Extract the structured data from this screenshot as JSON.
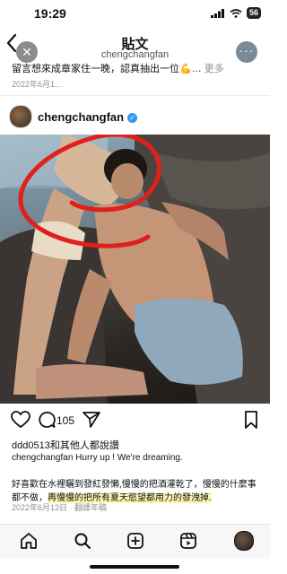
{
  "status": {
    "time": "19:29",
    "battery": "56"
  },
  "header": {
    "title": "貼文",
    "subtitle": "chengchangfan"
  },
  "previous_post": {
    "caption": "留言想來成章家住一晚，認真抽出一位💪…",
    "more": "更多",
    "date": "2022年6月1…"
  },
  "post": {
    "username": "chengchangfan",
    "likes_count": "105",
    "likes_text": "ddd0513和其他人都說讚",
    "caption_user": "chengchangfan",
    "caption_head": " Hurry up ! We're dreaming.",
    "caption_body": "好喜歡在水裡曬到發紅發懶,慢慢的把酒灌乾了，慢慢的什麼事都不做，",
    "caption_highlight": "再慢慢的把所有夏天慾望都用力的發洩掉.",
    "date": "2022年6月13日",
    "translate": "翻譯年稿"
  },
  "icons": {
    "back": "chevron-left-icon",
    "close": "close-icon",
    "more": "more-horizontal-icon",
    "like": "heart-icon",
    "comment": "comment-icon",
    "share": "send-icon",
    "save": "bookmark-icon",
    "home": "home-icon",
    "search": "search-icon",
    "create": "plus-square-icon",
    "reels": "reels-icon",
    "profile": "avatar"
  },
  "colors": {
    "annotation_circle": "#e0201b",
    "verified": "#3897f0",
    "highlight": "#fff4b0"
  }
}
